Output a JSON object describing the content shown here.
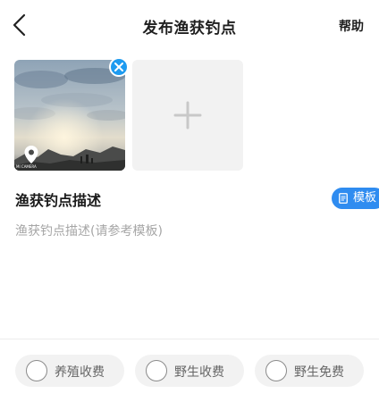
{
  "header": {
    "title": "发布渔获钓点",
    "help_label": "帮助"
  },
  "photos": {
    "thumbnail_caption": "MI CAMERA",
    "add_icon": "plus-icon",
    "remove_icon": "close-icon",
    "location_icon": "map-pin-icon"
  },
  "description": {
    "label": "渔获钓点描述",
    "template_label": "模板",
    "template_icon": "document-icon",
    "placeholder": "渔获钓点描述(请参考模板)",
    "value": ""
  },
  "fee_options": [
    {
      "label": "养殖收费",
      "selected": false
    },
    {
      "label": "野生收费",
      "selected": false
    },
    {
      "label": "野生免费",
      "selected": false
    }
  ],
  "colors": {
    "accent": "#2f8cf0",
    "remove_badge": "#1e9bf0",
    "tile_bg": "#f2f2f2"
  }
}
